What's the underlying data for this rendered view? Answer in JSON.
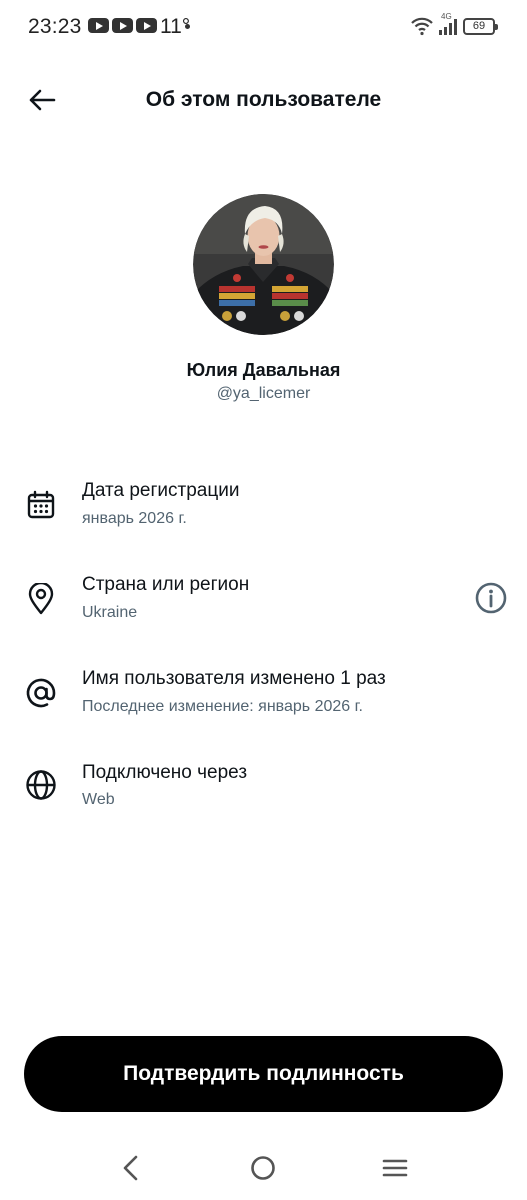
{
  "status_bar": {
    "time": "23:23",
    "temperature": "11°",
    "network": "4G",
    "battery": "69"
  },
  "header": {
    "title": "Об этом пользователе"
  },
  "profile": {
    "display_name": "Юлия Давальная",
    "handle": "@ya_licemer"
  },
  "info_rows": [
    {
      "icon": "calendar-icon",
      "title": "Дата регистрации",
      "subtitle": "январь 2026 г."
    },
    {
      "icon": "location-pin-icon",
      "title": "Страна или регион",
      "subtitle": "Ukraine"
    },
    {
      "icon": "at-sign-icon",
      "title": "Имя пользователя изменено 1 раз",
      "subtitle": "Последнее изменение: январь 2026 г."
    },
    {
      "icon": "globe-icon",
      "title": "Подключено через",
      "subtitle": "Web"
    }
  ],
  "actions": {
    "verify_label": "Подтвердить подлинность"
  },
  "colors": {
    "text_primary": "#0f1419",
    "text_secondary": "#536471",
    "button_bg": "#000000",
    "button_text": "#ffffff"
  }
}
